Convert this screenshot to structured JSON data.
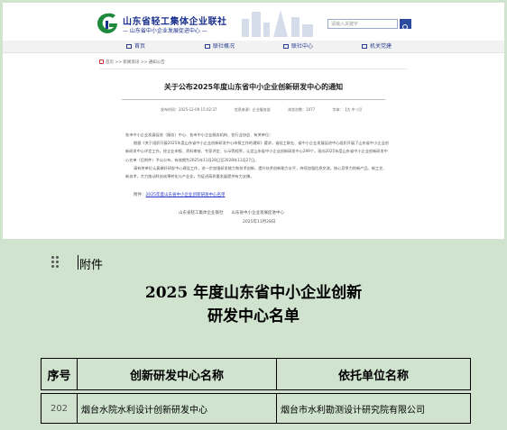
{
  "site": {
    "logo_title": "山东省轻工集体企业联社",
    "logo_subtitle": "— 山东省中小企业发展促进中心 —",
    "search_placeholder": "请输入关键字",
    "nav": [
      "首页",
      "联社概况",
      "联社中心",
      "机关党建"
    ],
    "breadcrumb": "首页 >> 新闻资讯 >> 通知公告",
    "article_title": "关于公布2025年度山东省中小企业创新研发中心的通知",
    "meta": {
      "date": "发布时间：2025-12-09 15:02:37",
      "source": "信息来源：企业服务部",
      "views": "浏览次数：1077",
      "font_size": "字体：【大 中 小】"
    },
    "salutation": "各市中小企业发展促进（服务）中心、各市中小企业服务机构、各行业协会、有关单位：",
    "paragraph1": "根据《关于组织开展2025年度山东省中小企业创新研发中心申报工作的通知》要求，省轻工联社、省中小企业发展促进中心组织开展了山东省中小企业创新研发中心评定工作。经企业申报、资料审核、专家评定、公示等程序，认定山东省中小企业创新研发中心299个，现向2025年度山东省中小企业创新研发中心名单（后附件）予以公布，有效期为2025年11月28日至2028年11月27日。",
    "paragraph2": "请有关单位认真做好研发中心建设工作，进一步加强研发能力和技术创新，提升技术创新能力水平，持续加强信息交流，核心竞争力的新产品、新工艺、新技术，大力推动科技成果转化与产业化，为促进高质量发展提供有力支撑。",
    "attachment_prefix": "附件：",
    "attachment_link": "2025年度山东省中小企业创新研发中心名单",
    "signature": "山东省轻工集体企业联社　　山东省中小企业发展促进中心",
    "sign_date": "2025年11月28日"
  },
  "document": {
    "attachment_label": "附件",
    "title_line1": "2025 年度山东省中小企业创新",
    "title_line2": "研发中心名单",
    "table": {
      "headers": [
        "序号",
        "创新研发中心名称",
        "依托单位名称"
      ],
      "rows": [
        [
          "202",
          "烟台水院水利设计创新研发中心",
          "烟台市水利勘测设计研究院有限公司"
        ]
      ]
    }
  },
  "colors": {
    "brand_blue": "#1a2f8c",
    "background_green": "#cfe3cf",
    "link_blue": "#2233cc"
  }
}
